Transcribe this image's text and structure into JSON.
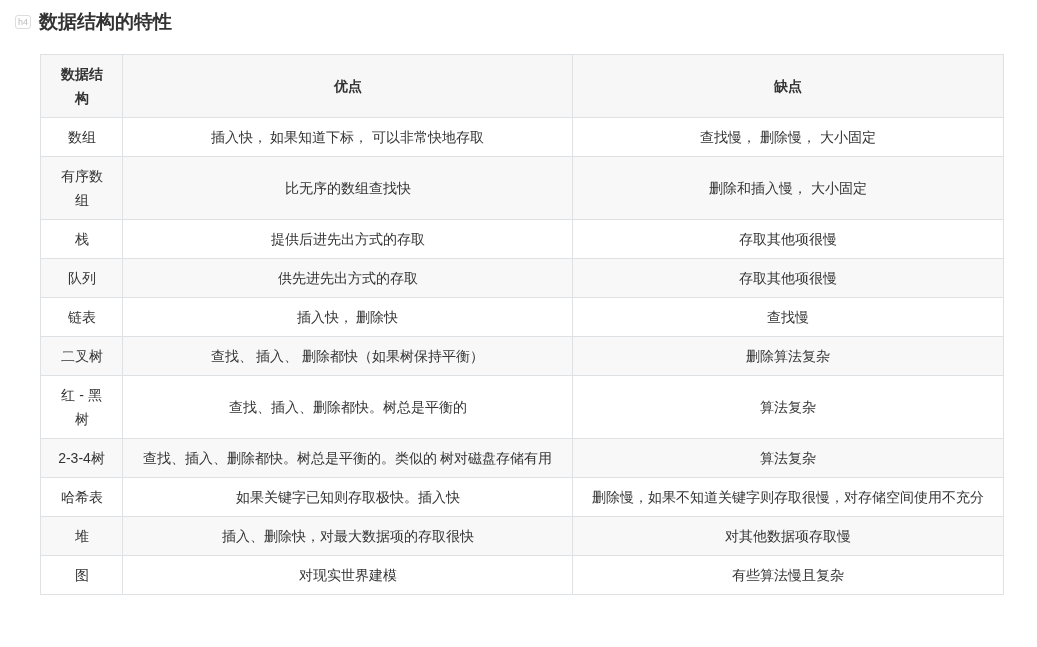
{
  "heading": {
    "badge": "h4",
    "title": "数据结构的特性"
  },
  "table": {
    "columns": [
      "数据结构",
      "优点",
      "缺点"
    ],
    "rows": [
      [
        "数组",
        "插入快， 如果知道下标， 可以非常快地存取",
        "查找慢， 删除慢， 大小固定"
      ],
      [
        "有序数组",
        "比无序的数组查找快",
        "删除和插入慢， 大小固定"
      ],
      [
        "栈",
        "提供后进先出方式的存取",
        "存取其他项很慢"
      ],
      [
        "队列",
        "供先进先出方式的存取",
        "存取其他项很慢"
      ],
      [
        "链表",
        "插入快， 删除快",
        "查找慢"
      ],
      [
        "二叉树",
        "查找、 插入、 删除都快（如果树保持平衡）",
        "删除算法复杂"
      ],
      [
        "红 - 黑树",
        "查找、插入、删除都快。树总是平衡的",
        "算法复杂"
      ],
      [
        "2-3-4树",
        "查找、插入、删除都快。树总是平衡的。类似的 树对磁盘存储有用",
        "算法复杂"
      ],
      [
        "哈希表",
        "如果关键字已知则存取极快。插入快",
        "删除慢，如果不知道关键字则存取很慢，对存储空间使用不充分"
      ],
      [
        "堆",
        "插入、删除快，对最大数据项的存取很快",
        "对其他数据项存取慢"
      ],
      [
        "图",
        "对现实世界建模",
        "有些算法慢且复杂"
      ]
    ]
  }
}
